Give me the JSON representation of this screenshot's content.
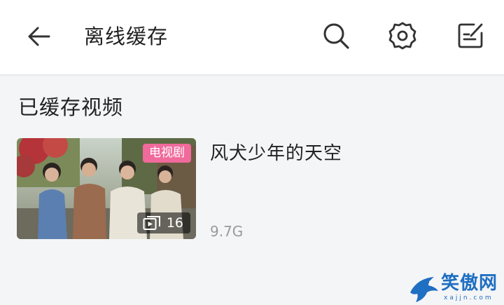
{
  "header": {
    "title": "离线缓存"
  },
  "section": {
    "title": "已缓存视频"
  },
  "videos": [
    {
      "title": "风犬少年的天空",
      "badge": "电视剧",
      "episode_count": "16",
      "size": "9.7G"
    }
  ],
  "watermark": {
    "brand": "笑傲网",
    "domain": "xajjn.com"
  },
  "colors": {
    "badge": "#f06a9b",
    "background": "#f4f5f7",
    "header": "#ffffff",
    "watermark": "#1f6fc2"
  },
  "icons": [
    "back-arrow-icon",
    "search-icon",
    "gear-icon",
    "edit-icon",
    "play-list-icon"
  ]
}
